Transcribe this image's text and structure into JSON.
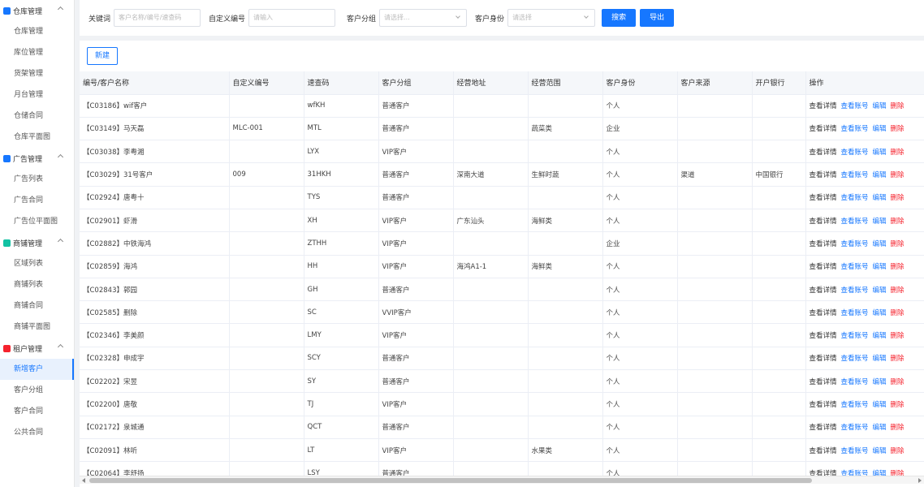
{
  "sidebar": {
    "groups": [
      {
        "label": "仓库管理",
        "icon": "warehouse-icon",
        "color": "#1677ff",
        "items": [
          "仓库管理",
          "库位管理",
          "货架管理",
          "月台管理",
          "仓储合同",
          "仓库平面图"
        ]
      },
      {
        "label": "广告管理",
        "icon": "ad-icon",
        "color": "#1677ff",
        "items": [
          "广告列表",
          "广告合同",
          "广告位平面图"
        ]
      },
      {
        "label": "商铺管理",
        "icon": "shop-icon",
        "color": "#13c2a3",
        "items": [
          "区域列表",
          "商铺列表",
          "商铺合同",
          "商铺平面图"
        ]
      },
      {
        "label": "租户管理",
        "icon": "tenant-icon",
        "color": "#f5222d",
        "items": [
          "新增客户",
          "客户分组",
          "客户合同",
          "公共合同"
        ]
      }
    ],
    "active_item": "新增客户"
  },
  "filters": {
    "keyword_label": "关键词",
    "keyword_placeholder": "客户名称/编号/速查码",
    "custom_no_label": "自定义编号",
    "custom_no_placeholder": "请输入",
    "group_label": "客户分组",
    "group_placeholder": "请选择...",
    "identity_label": "客户身份",
    "identity_placeholder": "请选择",
    "search_button": "搜索",
    "export_button": "导出"
  },
  "new_button": "新建",
  "table": {
    "columns": [
      "编号/客户名称",
      "自定义编号",
      "速查码",
      "客户分组",
      "经营地址",
      "经营范围",
      "客户身份",
      "客户来源",
      "开户银行",
      "操作"
    ],
    "ops": {
      "view": "查看详情",
      "account": "查看账号",
      "edit": "编辑",
      "delete": "删除"
    },
    "rows": [
      [
        "【C03186】wif客户",
        "",
        "wfKH",
        "普通客户",
        "",
        "",
        "个人",
        "",
        ""
      ],
      [
        "【C03149】马天磊",
        "MLC-001",
        "MTL",
        "普通客户",
        "",
        "蔬菜类",
        "企业",
        "",
        ""
      ],
      [
        "【C03038】李粤湘",
        "",
        "LYX",
        "VIP客户",
        "",
        "",
        "个人",
        "",
        ""
      ],
      [
        "【C03029】31号客户",
        "009",
        "31HKH",
        "普通客户",
        "深南大道",
        "生鲜时蔬",
        "个人",
        "渠道",
        "中国银行"
      ],
      [
        "【C02924】唐粤十",
        "",
        "TYS",
        "普通客户",
        "",
        "",
        "个人",
        "",
        ""
      ],
      [
        "【C02901】虾滑",
        "",
        "XH",
        "VIP客户",
        "广东汕头",
        "海鲜类",
        "个人",
        "",
        ""
      ],
      [
        "【C02882】中铁海鸿",
        "",
        "ZTHH",
        "VIP客户",
        "",
        "",
        "企业",
        "",
        ""
      ],
      [
        "【C02859】海鸿",
        "",
        "HH",
        "VIP客户",
        "海鸿A1-1",
        "海鲜类",
        "个人",
        "",
        ""
      ],
      [
        "【C02843】郭园",
        "",
        "GH",
        "普通客户",
        "",
        "",
        "个人",
        "",
        ""
      ],
      [
        "【C02585】删除",
        "",
        "SC",
        "VVIP客户",
        "",
        "",
        "个人",
        "",
        ""
      ],
      [
        "【C02346】李美颜",
        "",
        "LMY",
        "VIP客户",
        "",
        "",
        "个人",
        "",
        ""
      ],
      [
        "【C02328】申成宇",
        "",
        "SCY",
        "普通客户",
        "",
        "",
        "个人",
        "",
        ""
      ],
      [
        "【C02202】宋昱",
        "",
        "SY",
        "普通客户",
        "",
        "",
        "个人",
        "",
        ""
      ],
      [
        "【C02200】唐敬",
        "",
        "TJ",
        "VIP客户",
        "",
        "",
        "个人",
        "",
        ""
      ],
      [
        "【C02172】泉城通",
        "",
        "QCT",
        "普通客户",
        "",
        "",
        "个人",
        "",
        ""
      ],
      [
        "【C02091】林听",
        "",
        "LT",
        "VIP客户",
        "",
        "水果类",
        "个人",
        "",
        ""
      ],
      [
        "【C02064】李舒扬",
        "",
        "LSY",
        "普通客户",
        "",
        "",
        "个人",
        "",
        ""
      ]
    ]
  }
}
